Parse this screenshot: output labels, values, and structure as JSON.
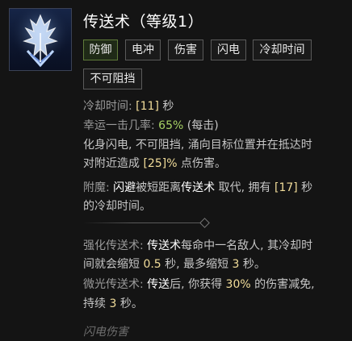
{
  "skill": {
    "title": "传送术（等级1）",
    "icon": "teleport-lightning-icon",
    "tags": [
      "防御",
      "电冲",
      "伤害",
      "闪电",
      "冷却时间",
      "不可阻挡"
    ],
    "active_tag": "防御"
  },
  "stats": {
    "cooldown_label": "冷却时间: ",
    "cooldown_value": "[11]",
    "cooldown_unit": " 秒",
    "lucky_label": "幸运一击几率: ",
    "lucky_value": "65%",
    "lucky_suffix": " (每击)"
  },
  "description": {
    "line1": "化身闪电, 不可阻挡, 涌向目标位置并在抵达时",
    "line2_a": "对附近造成 ",
    "line2_val": "[25]%",
    "line2_b": " 点伤害。"
  },
  "enchant": {
    "label": "附魔: ",
    "evade": "闪避",
    "text_a": "被短距离",
    "skill": "传送术",
    "text_b": "取代, 拥有 ",
    "val": "[17]",
    "text_c": " 秒",
    "line2": "的冷却时间。"
  },
  "upgrade1": {
    "label": "强化传送术: ",
    "skill": "传送术",
    "text_a": "每命中一名敌人, 其冷却时",
    "line2_a": "间就会缩短 ",
    "val1": "0.5",
    "line2_b": " 秒, 最多缩短 ",
    "val2": "3",
    "line2_c": " 秒。"
  },
  "upgrade2": {
    "label": "微光传送术: ",
    "skill": "传送",
    "text_a": "后, 你获得 ",
    "val": "30%",
    "text_b": " 的伤害减免,",
    "line2_a": "持续 ",
    "val2": "3",
    "line2_b": " 秒。"
  },
  "footer": "闪电伤害",
  "colors": {
    "background": "#141414",
    "value_gold": "#f2dd9a",
    "value_green": "#a6d064",
    "tag_active_border": "#5f7b3a"
  }
}
